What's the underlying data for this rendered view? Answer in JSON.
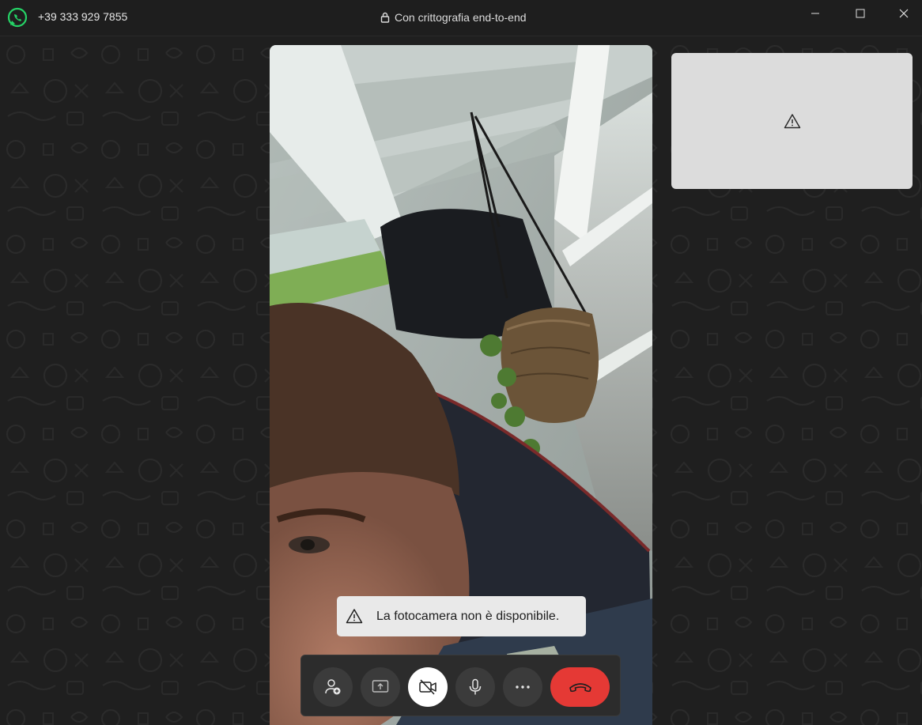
{
  "titlebar": {
    "caller_number": "+39 333 929 7855",
    "encryption_text": "Con crittografia end-to-end",
    "window_controls": [
      "minimize-icon",
      "maximize-icon",
      "close-icon"
    ]
  },
  "call": {
    "remote_video": "camera-feed",
    "self_view_status": "warning-icon",
    "notice": "La fotocamera non è disponibile."
  },
  "controls": [
    {
      "name": "add-participant",
      "icon": "person-add-icon"
    },
    {
      "name": "share-screen",
      "icon": "share-screen-icon"
    },
    {
      "name": "toggle-camera",
      "icon": "camera-off-icon",
      "active": true
    },
    {
      "name": "toggle-microphone",
      "icon": "microphone-icon"
    },
    {
      "name": "more-options",
      "icon": "more-icon"
    },
    {
      "name": "end-call",
      "icon": "hang-up-icon"
    }
  ],
  "colors": {
    "background": "#1e1e1e",
    "brand": "#25d366",
    "end_call": "#e53935",
    "toast_bg": "#e9e9e9"
  }
}
